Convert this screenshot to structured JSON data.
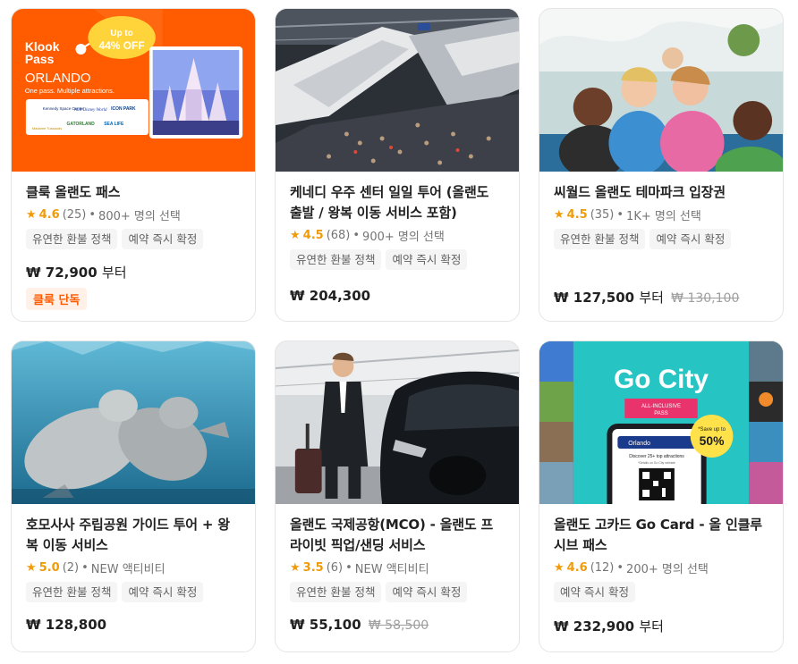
{
  "cards": [
    {
      "title": "클룩 올랜도 패스",
      "star": "★",
      "score": "4.6",
      "reviews": "(25)",
      "bullet": "•",
      "booked": "800+ 명의 선택",
      "tags": [
        "유연한 환불 정책",
        "예약 즉시 확정"
      ],
      "price": "₩ 72,900",
      "from": "부터",
      "old_price": "",
      "badge": "클룩 단독",
      "image": {
        "brand_line1": "Klook",
        "brand_line2": "Pass",
        "promo_line1": "Up to",
        "promo_line2": "44% OFF",
        "city": "ORLANDO",
        "tagline": "One pass. Multiple attractions.",
        "logos": [
          "Kennedy Space Center",
          "Walt Disney World",
          "ICON PARK",
          "GATORLAND",
          "SEA LIFE",
          "Madame Tussauds"
        ]
      }
    },
    {
      "title": "케네디 우주 센터 일일 투어 (올랜도 출발 / 왕복 이동 서비스 포함)",
      "star": "★",
      "score": "4.5",
      "reviews": "(68)",
      "bullet": "•",
      "booked": "900+ 명의 선택",
      "tags": [
        "유연한 환불 정책",
        "예약 즉시 확정"
      ],
      "price": "₩ 204,300",
      "from": "",
      "old_price": "",
      "badge": ""
    },
    {
      "title": "씨월드 올랜도 테마파크 입장권",
      "star": "★",
      "score": "4.5",
      "reviews": "(35)",
      "bullet": "•",
      "booked": "1K+ 명의 선택",
      "tags": [
        "유연한 환불 정책",
        "예약 즉시 확정"
      ],
      "price": "₩ 127,500",
      "from": "부터",
      "old_price": "₩ 130,100",
      "badge": ""
    },
    {
      "title": "호모사사 주립공원 가이드 투어 + 왕복 이동 서비스",
      "star": "★",
      "score": "5.0",
      "reviews": "(2)",
      "bullet": "•",
      "booked": "NEW 액티비티",
      "tags": [
        "유연한 환불 정책",
        "예약 즉시 확정"
      ],
      "price": "₩ 128,800",
      "from": "",
      "old_price": "",
      "badge": ""
    },
    {
      "title": "올랜도 국제공항(MCO) - 올랜도 프라이빗 픽업/샌딩 서비스",
      "star": "★",
      "score": "3.5",
      "reviews": "(6)",
      "bullet": "•",
      "booked": "NEW 액티비티",
      "tags": [
        "유연한 환불 정책",
        "예약 즉시 확정"
      ],
      "price": "₩ 55,100",
      "from": "",
      "old_price": "₩ 58,500",
      "badge": ""
    },
    {
      "title": "올랜도 고카드 Go Card - 올 인클루시브 패스",
      "star": "★",
      "score": "4.6",
      "reviews": "(12)",
      "bullet": "•",
      "booked": "200+ 명의 선택",
      "tags": [
        "예약 즉시 확정"
      ],
      "price": "₩ 232,900",
      "from": "부터",
      "old_price": "",
      "badge": "",
      "image": {
        "logo": "Go City",
        "pass_line1": "ALL-INCLUSIVE",
        "pass_line2": "PASS",
        "promo_line1": "*Save up to",
        "promo_line2": "50%",
        "phone_city": "Orlando",
        "phone_text1": "Discover 25+ top attractions",
        "phone_text2": "*Details on Go City website"
      }
    }
  ]
}
